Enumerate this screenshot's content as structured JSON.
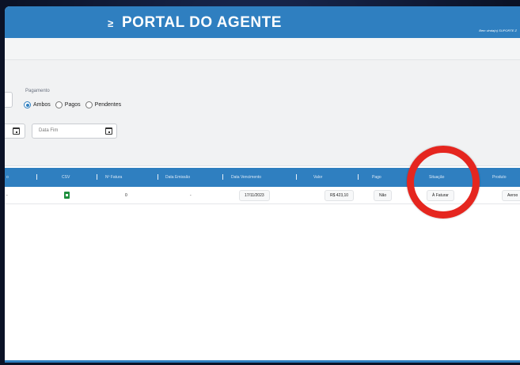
{
  "header": {
    "title": "PORTAL DO AGENTE",
    "menu_icon": "menu-icon",
    "welcome": "Bem vinda(o) SUPORTE Z",
    "bg_color": "#2f7fc0"
  },
  "filters": {
    "payment_label": "Pagamento",
    "payment_options": [
      {
        "label": "Ambos",
        "checked": true
      },
      {
        "label": "Pagos",
        "checked": false
      },
      {
        "label": "Pendentes",
        "checked": false
      }
    ],
    "date_end_placeholder": "Data Fim",
    "calendar_icon": "calendar-icon"
  },
  "table": {
    "headers": [
      "o",
      "CSV",
      "Nº Fatura",
      "Data Emissão",
      "Data Vencimento",
      "Valor",
      "Pago",
      "Situação",
      "Produto"
    ],
    "rows": [
      {
        "first": "-",
        "csv_icon": "csv-file-icon",
        "fatura": "0",
        "emissao": "-",
        "vencimento": "17/11/2023",
        "valor": "R$ 423,10",
        "pago": "Não",
        "situacao": "À Faturar",
        "produto": "Aeroo"
      }
    ]
  },
  "annotation": {
    "highlight_color": "#e5261f"
  }
}
